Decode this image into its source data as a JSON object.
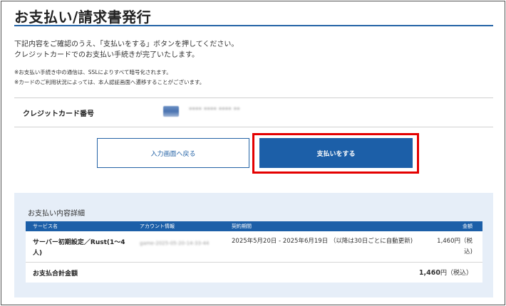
{
  "header": {
    "title": "お支払い/請求書発行"
  },
  "intro": {
    "line1": "下記内容をご確認のうえ、「支払いをする」ボタンを押してください。",
    "line2": "クレジットカードでのお支払い手続きが完了いたします。"
  },
  "notes": {
    "note1": "※お支払い手続き中の通信は、SSLによりすべて暗号化されます。",
    "note2": "※カードのご利用状況によっては、本人認証画面へ遷移することがございます。"
  },
  "card": {
    "label": "クレジットカード番号",
    "number": "**** **** **** **"
  },
  "buttons": {
    "back_label": "入力画面へ戻る",
    "pay_label": "支払いをする"
  },
  "details": {
    "title": "お支払い内容詳細",
    "columns": [
      "サービス名",
      "アカウント情報",
      "契約期間",
      "金額"
    ],
    "rows": [
      {
        "service": "サーバー初期設定／Rust(1〜4人)",
        "account": "game-2025-05-20-14-33-44",
        "period": "2025年5月20日 - 2025年6月19日 （以降は30日ごとに自動更新)",
        "amount": "1,460円（税",
        "amount_tax": "込)"
      }
    ],
    "total_label": "お支払合計金額",
    "total_value": "1,460",
    "total_unit": "円（税込）"
  },
  "colors": {
    "accent": "#1c5fa8",
    "highlight": "#e40000",
    "panel": "#e6eef8"
  },
  "icons": {
    "card_logo": "credit-card-brand-icon"
  }
}
